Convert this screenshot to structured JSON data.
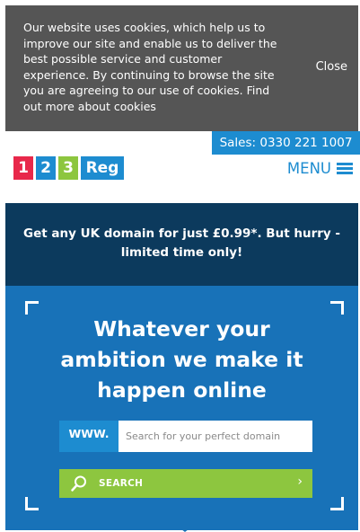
{
  "cookie_banner": {
    "lines": [
      "Our website uses cookies, which help us to",
      "improve our site and enable us to deliver the",
      "best possible service and customer",
      "experience. By continuing to browse the site",
      "you are agreeing to our use of cookies. Find",
      "out more about cookies"
    ],
    "close_label": "Close"
  },
  "header": {
    "sales_label": "Sales: 0330 221 1007",
    "logo": {
      "part1": "1",
      "part2": "2",
      "part3": "3",
      "part4": "Reg"
    },
    "menu_label": "MENU",
    "menu_icon": "hamburger-icon"
  },
  "promo": {
    "line1": "Get any UK domain for just £0.99*. But hurry -",
    "line2": "limited time only!"
  },
  "hero": {
    "title_lines": [
      "Whatever your",
      "ambition we make it",
      "happen online"
    ],
    "www_label": "WWW.",
    "search_placeholder": "Search for your perfect domain",
    "search_button_label": "SEARCH",
    "search_icon": "search-icon",
    "chevron_icon": "chevron-right-icon"
  },
  "colors": {
    "brand_blue": "#1d8cd0",
    "hero_blue": "#1872b8",
    "navy": "#0c3a5d",
    "green": "#8dc63f",
    "red": "#e8284a",
    "cookie_gray": "#555555"
  }
}
